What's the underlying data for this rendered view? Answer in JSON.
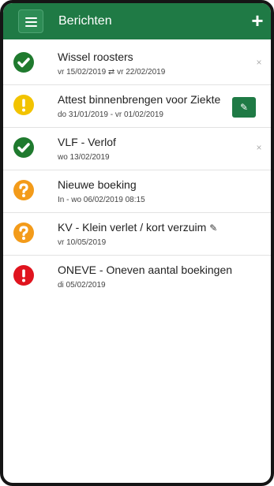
{
  "header": {
    "title": "Berichten",
    "menu_icon": "hamburger-icon",
    "add_icon": "plus-icon",
    "accent": "#1f7a45"
  },
  "items": [
    {
      "status": "approved",
      "status_icon": "check-icon",
      "color": "#1f7a2e",
      "title": "Wissel roosters",
      "subtitle": "vr 15/02/2019 ⇄ vr 22/02/2019",
      "action": "close",
      "action_label": "×"
    },
    {
      "status": "warning",
      "status_icon": "exclamation-icon",
      "color": "#f2c300",
      "title": "Attest binnenbrengen voor Ziekte",
      "subtitle": "do 31/01/2019 - vr 01/02/2019",
      "action": "attach",
      "action_label": "✎"
    },
    {
      "status": "approved",
      "status_icon": "check-icon",
      "color": "#1f7a2e",
      "title": "VLF - Verlof",
      "subtitle": "wo 13/02/2019",
      "action": "close",
      "action_label": "×"
    },
    {
      "status": "pending",
      "status_icon": "question-icon",
      "color": "#f39b1a",
      "title": "Nieuwe boeking",
      "subtitle": "In - wo 06/02/2019 08:15",
      "action": "none",
      "action_label": ""
    },
    {
      "status": "pending",
      "status_icon": "question-icon",
      "color": "#f39b1a",
      "title": "KV - Klein verlet / kort verzuim",
      "subtitle": "vr 10/05/2019",
      "action": "none",
      "action_label": "",
      "has_attachment": true,
      "attachment_glyph": "✎"
    },
    {
      "status": "error",
      "status_icon": "exclamation-icon",
      "color": "#e0141e",
      "title": "ONEVE - Oneven aantal boekingen",
      "subtitle": "di 05/02/2019",
      "action": "none",
      "action_label": ""
    }
  ]
}
